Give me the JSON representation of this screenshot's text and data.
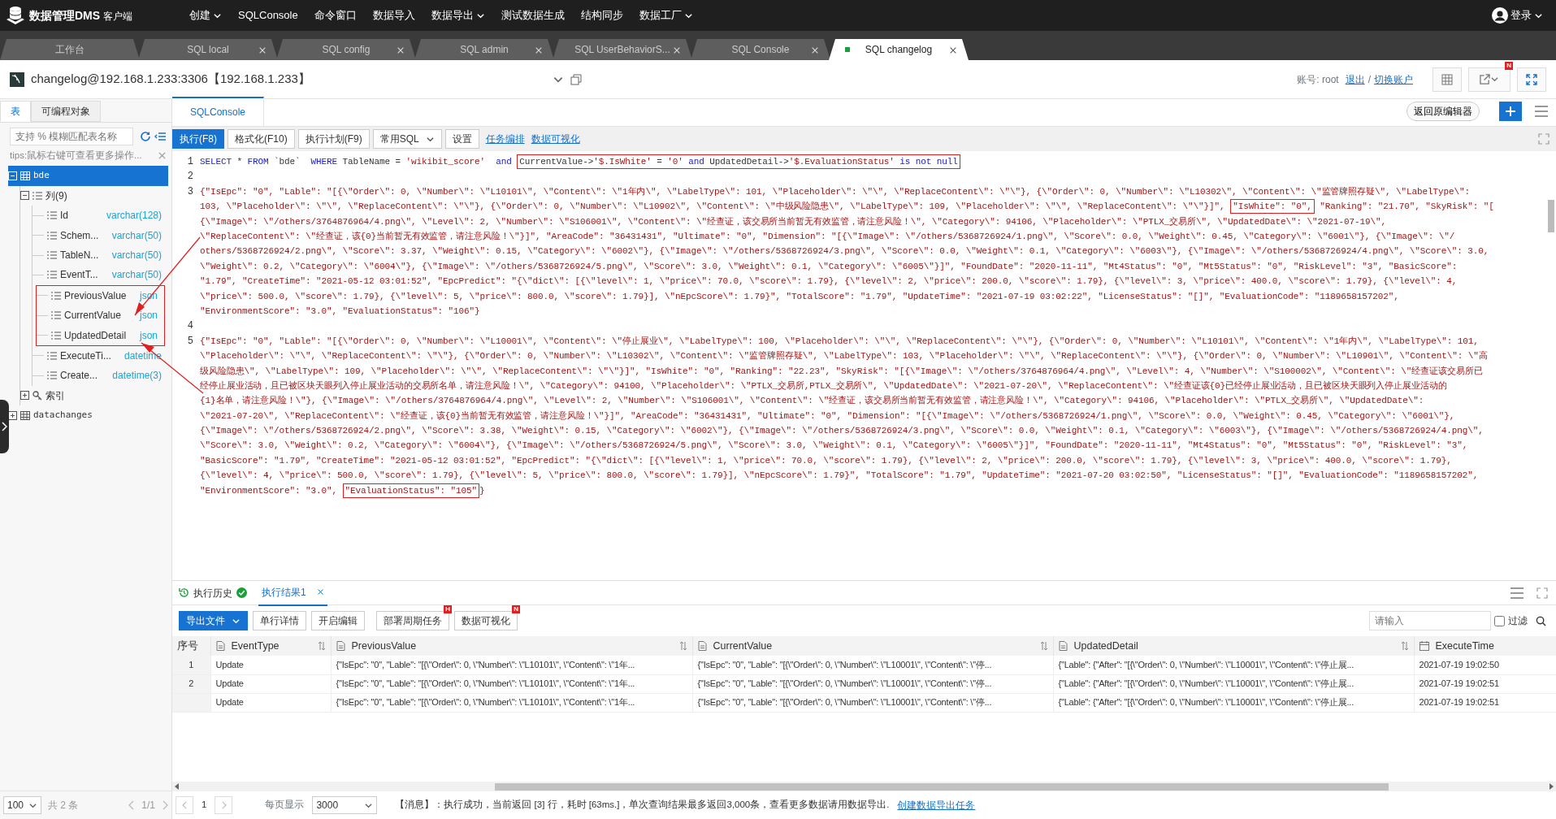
{
  "app": {
    "logo_text": "数据管理DMS",
    "logo_suffix": "客户端",
    "menu": [
      {
        "label": "创建",
        "dropdown": true
      },
      {
        "label": "SQLConsole",
        "dropdown": false
      },
      {
        "label": "命令窗口",
        "dropdown": false
      },
      {
        "label": "数据导入",
        "dropdown": false
      },
      {
        "label": "数据导出",
        "dropdown": true
      },
      {
        "label": "测试数据生成",
        "dropdown": false
      },
      {
        "label": "结构同步",
        "dropdown": false
      },
      {
        "label": "数据工厂",
        "dropdown": true
      }
    ],
    "user": "登录"
  },
  "tabs": [
    {
      "label": "工作台",
      "closable": false,
      "selected": false
    },
    {
      "label": "SQL local",
      "closable": true,
      "selected": false
    },
    {
      "label": "SQL config",
      "closable": true,
      "selected": false
    },
    {
      "label": "SQL admin",
      "closable": true,
      "selected": false
    },
    {
      "label": "SQL UserBehaviorS...",
      "closable": true,
      "selected": false
    },
    {
      "label": "SQL Console",
      "closable": true,
      "selected": false
    },
    {
      "label": "SQL changelog",
      "closable": true,
      "selected": true
    }
  ],
  "connection": {
    "title": "changelog@192.168.1.233:3306【192.168.1.233】",
    "account": "账号: root",
    "logout": "退出",
    "separator": "/",
    "switch": "切换账户",
    "badge": "N"
  },
  "sidebar": {
    "tabs": [
      {
        "label": "表",
        "selected": true
      },
      {
        "label": "可编程对象",
        "selected": false
      }
    ],
    "search": {
      "placeholder": "支持 % 模糊匹配表名称"
    },
    "tip": "tips:鼠标右键可查看更多操作...",
    "tree": [
      {
        "label": "bde",
        "kind": "table",
        "selected": true,
        "expanded": true,
        "children": [
          {
            "label": "列(9)",
            "kind": "group",
            "selected": false,
            "expanded": true,
            "children": [
              {
                "label": "Id",
                "kind": "column",
                "type": "varchar(128)",
                "boxed": false,
                "selected": false
              },
              {
                "label": "Schem...",
                "kind": "column",
                "type": "varchar(50)",
                "boxed": false,
                "selected": false
              },
              {
                "label": "TableN...",
                "kind": "column",
                "type": "varchar(50)",
                "boxed": false,
                "selected": false
              },
              {
                "label": "EventT...",
                "kind": "column",
                "type": "varchar(50)",
                "boxed": false,
                "selected": false
              },
              {
                "label": "PreviousValue",
                "kind": "column",
                "type": "json",
                "boxed": true,
                "selected": false
              },
              {
                "label": "CurrentValue",
                "kind": "column",
                "type": "json",
                "boxed": true,
                "selected": false
              },
              {
                "label": "UpdatedDetail",
                "kind": "column",
                "type": "json",
                "boxed": true,
                "selected": false
              },
              {
                "label": "ExecuteTi...",
                "kind": "column",
                "type": "datetime",
                "boxed": false,
                "selected": false
              },
              {
                "label": "Create...",
                "kind": "column",
                "type": "datetime(3)",
                "boxed": false,
                "selected": false
              }
            ]
          },
          {
            "label": "索引",
            "kind": "index",
            "selected": false,
            "expanded": false
          }
        ]
      },
      {
        "label": "datachanges",
        "kind": "table",
        "selected": false,
        "expanded": false
      }
    ],
    "pager": {
      "page_size": "100",
      "total": "共 2 条",
      "page": "1/1"
    }
  },
  "console": {
    "tabs": [
      {
        "label": "SQLConsole",
        "selected": true
      }
    ],
    "back_button": "返回原编辑器",
    "toolbar": [
      {
        "label": "执行(F8)",
        "kind": "primary"
      },
      {
        "label": "格式化(F10)",
        "kind": "button"
      },
      {
        "label": "执行计划(F9)",
        "kind": "button"
      },
      {
        "label": "常用SQL",
        "kind": "dropdown"
      },
      {
        "label": "设置",
        "kind": "button"
      },
      {
        "label": "任务编排",
        "kind": "link"
      },
      {
        "label": "数据可视化",
        "kind": "link"
      }
    ],
    "editor": {
      "lines": [
        {
          "number": "1",
          "rows": [
            [
              {
                "kind": "sql",
                "tokens": [
                  {
                    "kind": "keyword",
                    "text": "SELECT"
                  },
                  {
                    "kind": "plain",
                    "text": " * "
                  },
                  {
                    "kind": "keyword",
                    "text": "FROM"
                  },
                  {
                    "kind": "plain",
                    "text": " `bde`  "
                  },
                  {
                    "kind": "keyword",
                    "text": "WHERE"
                  },
                  {
                    "kind": "plain",
                    "text": " TableName = "
                  },
                  {
                    "kind": "string",
                    "text": "'wikibit_score'"
                  },
                  {
                    "kind": "keyword",
                    "text": "  and"
                  }
                ]
              },
              {
                "kind": "box",
                "parts": [
                  {
                    "kind": "sql",
                    "tokens": [
                      {
                        "kind": "plain",
                        "text": "CurrentValue->"
                      },
                      {
                        "kind": "string",
                        "text": "'$.IsWhite'"
                      },
                      {
                        "kind": "plain",
                        "text": " = "
                      },
                      {
                        "kind": "string",
                        "text": "'0'"
                      },
                      {
                        "kind": "keyword",
                        "text": " and"
                      },
                      {
                        "kind": "plain",
                        "text": " UpdatedDetail->"
                      },
                      {
                        "kind": "string",
                        "text": "'$.EvaluationStatus'"
                      },
                      {
                        "kind": "keyword",
                        "text": " is not null"
                      }
                    ]
                  }
                ]
              }
            ]
          ]
        },
        {
          "number": "2"
        },
        {
          "number": "3",
          "rows": [
            [
              {
                "kind": "json",
                "text": "{\"IsEpc\": \"0\", \"Lable\": \"[{\\\"Order\\\": 0, \\\"Number\\\": \\\"L10101\\\", \\\"Content\\\": \\\"1年内\\\", \\\"LabelType\\\": 101, \\\"Placeholder\\\": \\\"\\\", \\\"ReplaceContent\\\": \\\"\\\"}, {\\\"Order\\\": 0, \\\"Number\\\": \\\"L10302\\\", \\\"Content\\\": \\\"监管牌照存疑\\\", \\\"LabelType\\\":"
              }
            ],
            [
              {
                "kind": "json",
                "text": "103, \\\"Placeholder\\\": \\\"\\\", \\\"ReplaceContent\\\": \\\"\\\"}, {\\\"Order\\\": 0, \\\"Number\\\": \\\"L10902\\\", \\\"Content\\\": \\\"中级风险隐患\\\", \\\"LabelType\\\": 109, \\\"Placeholder\\\": \\\"\\\", \\\"ReplaceContent\\\": \\\"\\\"}]\","
              },
              {
                "kind": "box",
                "parts": [
                  {
                    "kind": "json",
                    "text": "\"IsWhite\": \"0\","
                  }
                ]
              },
              {
                "kind": "json",
                "text": "\"Ranking\": \"21.70\", \"SkyRisk\": \"["
              }
            ],
            [
              {
                "kind": "json",
                "text": "{\\\"Image\\\": \\\"/others/3764876964/4.png\\\", \\\"Level\\\": 2, \\\"Number\\\": \\\"S106001\\\", \\\"Content\\\": \\\"经查证，该交易所当前暂无有效监管，请注意风险！\\\", \\\"Category\\\": 94106, \\\"Placeholder\\\": \\\"PTLX_交易所\\\", \\\"UpdatedDate\\\": \\\"2021-07-19\\\","
              }
            ],
            [
              {
                "kind": "json",
                "text": "\\\"ReplaceContent\\\": \\\"经查证，该{0}当前暂无有效监管，请注意风险！\\\"}]\", \"AreaCode\": \"36431431\", \"Ultimate\": \"0\", \"Dimension\": \"[{\\\"Image\\\": \\\"/others/5368726924/1.png\\\", \\\"Score\\\": 0.0, \\\"Weight\\\": 0.45, \\\"Category\\\": \\\"6001\\\"}, {\\\"Image\\\": \\\"/"
              }
            ],
            [
              {
                "kind": "json",
                "text": "others/5368726924/2.png\\\", \\\"Score\\\": 3.37, \\\"Weight\\\": 0.15, \\\"Category\\\": \\\"6002\\\"}, {\\\"Image\\\": \\\"/others/5368726924/3.png\\\", \\\"Score\\\": 0.0, \\\"Weight\\\": 0.1, \\\"Category\\\": \\\"6003\\\"}, {\\\"Image\\\": \\\"/others/5368726924/4.png\\\", \\\"Score\\\": 3.0,"
              }
            ],
            [
              {
                "kind": "json",
                "text": "\\\"Weight\\\": 0.2, \\\"Category\\\": \\\"6004\\\"}, {\\\"Image\\\": \\\"/others/5368726924/5.png\\\", \\\"Score\\\": 3.0, \\\"Weight\\\": 0.1, \\\"Category\\\": \\\"6005\\\"}]\", \"FoundDate\": \"2020-11-11\", \"Mt4Status\": \"0\", \"Mt5Status\": \"0\", \"RiskLevel\": \"3\", \"BasicScore\":"
              }
            ],
            [
              {
                "kind": "json",
                "text": "\"1.79\", \"CreateTime\": \"2021-05-12 03:01:52\", \"EpcPredict\": \"{\\\"dict\\\": [{\\\"level\\\": 1, \\\"price\\\": 70.0, \\\"score\\\": 1.79}, {\\\"level\\\": 2, \\\"price\\\": 200.0, \\\"score\\\": 1.79}, {\\\"level\\\": 3, \\\"price\\\": 400.0, \\\"score\\\": 1.79}, {\\\"level\\\": 4,"
              }
            ],
            [
              {
                "kind": "json",
                "text": "\\\"price\\\": 500.0, \\\"score\\\": 1.79}, {\\\"level\\\": 5, \\\"price\\\": 800.0, \\\"score\\\": 1.79}], \\\"nEpcScore\\\": 1.79}\", \"TotalScore\": \"1.79\", \"UpdateTime\": \"2021-07-19 03:02:22\", \"LicenseStatus\": \"[]\", \"EvaluationCode\": \"1189658157202\","
              }
            ],
            [
              {
                "kind": "json",
                "text": "\"EnvironmentScore\": \"3.0\", \"EvaluationStatus\": \"106\"}"
              }
            ]
          ]
        },
        {
          "number": "4"
        },
        {
          "number": "5",
          "rows": [
            [
              {
                "kind": "json",
                "text": "{\"IsEpc\": \"0\", \"Lable\": \"[{\\\"Order\\\": 0, \\\"Number\\\": \\\"L10001\\\", \\\"Content\\\": \\\"停止展业\\\", \\\"LabelType\\\": 100, \\\"Placeholder\\\": \\\"\\\", \\\"ReplaceContent\\\": \\\"\\\"}, {\\\"Order\\\": 0, \\\"Number\\\": \\\"L10101\\\", \\\"Content\\\": \\\"1年内\\\", \\\"LabelType\\\": 101,"
              }
            ],
            [
              {
                "kind": "json",
                "text": "\\\"Placeholder\\\": \\\"\\\", \\\"ReplaceContent\\\": \\\"\\\"}, {\\\"Order\\\": 0, \\\"Number\\\": \\\"L10302\\\", \\\"Content\\\": \\\"监管牌照存疑\\\", \\\"LabelType\\\": 103, \\\"Placeholder\\\": \\\"\\\", \\\"ReplaceContent\\\": \\\"\\\"}, {\\\"Order\\\": 0, \\\"Number\\\": \\\"L10901\\\", \\\"Content\\\": \\\"高"
              }
            ],
            [
              {
                "kind": "json",
                "text": "级风险隐患\\\", \\\"LabelType\\\": 109, \\\"Placeholder\\\": \\\"\\\", \\\"ReplaceContent\\\": \\\"\\\"}]\", \"IsWhite\": \"0\", \"Ranking\": \"22.23\", \"SkyRisk\": \"[{\\\"Image\\\": \\\"/others/3764876964/4.png\\\", \\\"Level\\\": 4, \\\"Number\\\": \\\"S100002\\\", \\\"Content\\\": \\\"经查证该交易所已"
              }
            ],
            [
              {
                "kind": "json",
                "text": "经停止展业活动，且已被区块天眼列入停止展业活动的交易所名单，请注意风险！\\\", \\\"Category\\\": 94100, \\\"Placeholder\\\": \\\"PTLX_交易所,PTLX_交易所\\\", \\\"UpdatedDate\\\": \\\"2021-07-20\\\", \\\"ReplaceContent\\\": \\\"经查证该{0}已经停止展业活动，且已被区块天眼列入停止展业活动的"
              }
            ],
            [
              {
                "kind": "json",
                "text": "{1}名单，请注意风险！\\\"}, {\\\"Image\\\": \\\"/others/3764876964/4.png\\\", \\\"Level\\\": 2, \\\"Number\\\": \\\"S106001\\\", \\\"Content\\\": \\\"经查证，该交易所当前暂无有效监管，请注意风险！\\\", \\\"Category\\\": 94106, \\\"Placeholder\\\": \\\"PTLX_交易所\\\", \\\"UpdatedDate\\\":"
              }
            ],
            [
              {
                "kind": "json",
                "text": "\\\"2021-07-20\\\", \\\"ReplaceContent\\\": \\\"经查证，该{0}当前暂无有效监管，请注意风险！\\\"}]\", \"AreaCode\": \"36431431\", \"Ultimate\": \"0\", \"Dimension\": \"[{\\\"Image\\\": \\\"/others/5368726924/1.png\\\", \\\"Score\\\": 0.0, \\\"Weight\\\": 0.45, \\\"Category\\\": \\\"6001\\\"},"
              }
            ],
            [
              {
                "kind": "json",
                "text": "{\\\"Image\\\": \\\"/others/5368726924/2.png\\\", \\\"Score\\\": 3.38, \\\"Weight\\\": 0.15, \\\"Category\\\": \\\"6002\\\"}, {\\\"Image\\\": \\\"/others/5368726924/3.png\\\", \\\"Score\\\": 0.0, \\\"Weight\\\": 0.1, \\\"Category\\\": \\\"6003\\\"}, {\\\"Image\\\": \\\"/others/5368726924/4.png\\\","
              }
            ],
            [
              {
                "kind": "json",
                "text": "\\\"Score\\\": 3.0, \\\"Weight\\\": 0.2, \\\"Category\\\": \\\"6004\\\"}, {\\\"Image\\\": \\\"/others/5368726924/5.png\\\", \\\"Score\\\": 3.0, \\\"Weight\\\": 0.1, \\\"Category\\\": \\\"6005\\\"}]\", \"FoundDate\": \"2020-11-11\", \"Mt4Status\": \"0\", \"Mt5Status\": \"0\", \"RiskLevel\": \"3\","
              }
            ],
            [
              {
                "kind": "json",
                "text": "\"BasicScore\": \"1.79\", \"CreateTime\": \"2021-05-12 03:01:52\", \"EpcPredict\": \"{\\\"dict\\\": [{\\\"level\\\": 1, \\\"price\\\": 70.0, \\\"score\\\": 1.79}, {\\\"level\\\": 2, \\\"price\\\": 200.0, \\\"score\\\": 1.79}, {\\\"level\\\": 3, \\\"price\\\": 400.0, \\\"score\\\": 1.79},"
              }
            ],
            [
              {
                "kind": "json",
                "text": "{\\\"level\\\": 4, \\\"price\\\": 500.0, \\\"score\\\": 1.79}, {\\\"level\\\": 5, \\\"price\\\": 800.0, \\\"score\\\": 1.79}], \\\"nEpcScore\\\": 1.79}\", \"TotalScore\": \"1.79\", \"UpdateTime\": \"2021-07-20 03:02:50\", \"LicenseStatus\": \"[]\", \"EvaluationCode\": \"1189658157202\","
              }
            ],
            [
              {
                "kind": "json",
                "text": "\"EnvironmentScore\": \"3.0\","
              },
              {
                "kind": "box",
                "parts": [
                  {
                    "kind": "json",
                    "text": "\"EvaluationStatus\": \"105\""
                  }
                ]
              },
              {
                "kind": "json",
                "text": "}"
              }
            ]
          ]
        }
      ]
    }
  },
  "results": {
    "tabs": [
      {
        "label": "执行历史",
        "kind": "history",
        "selected": false
      },
      {
        "label": "执行结果1",
        "kind": "result",
        "selected": true
      }
    ],
    "toolbar": [
      {
        "label": "导出文件",
        "kind": "primary-dropdown"
      },
      {
        "label": "单行详情",
        "kind": "button"
      },
      {
        "label": "开启编辑",
        "kind": "button"
      },
      {
        "label": "部署周期任务",
        "kind": "button",
        "badge": "H"
      },
      {
        "label": "数据可视化",
        "kind": "button",
        "badge": "N"
      }
    ],
    "search": {
      "placeholder": "请输入"
    },
    "filter": {
      "label": "过滤",
      "checked": false
    },
    "table": {
      "columns": [
        {
          "label": "序号",
          "kind": "index"
        },
        {
          "label": "EventType",
          "kind": "field"
        },
        {
          "label": "PreviousValue",
          "kind": "field"
        },
        {
          "label": "CurrentValue",
          "kind": "field"
        },
        {
          "label": "UpdatedDetail",
          "kind": "field"
        },
        {
          "label": "ExecuteTime",
          "kind": "time"
        }
      ],
      "rows": [
        {
          "cells": [
            "1",
            "Update",
            "{\"IsEpc\": \"0\", \"Lable\": \"[{\\\"Order\\\": 0, \\\"Number\\\": \\\"L10101\\\", \\\"Content\\\": \\\"1年...",
            "{\"IsEpc\": \"0\", \"Lable\": \"[{\\\"Order\\\": 0, \\\"Number\\\": \\\"L10001\\\", \\\"Content\\\": \\\"停...",
            "{\"Lable\": {\"After\": \"[{\\\"Order\\\": 0, \\\"Number\\\": \\\"L10001\\\", \\\"Content\\\": \\\"停止展...",
            "2021-07-19 19:02:50"
          ]
        },
        {
          "cells": [
            "2",
            "Update",
            "{\"IsEpc\": \"0\", \"Lable\": \"[{\\\"Order\\\": 0, \\\"Number\\\": \\\"L10101\\\", \\\"Content\\\": \\\"1年...",
            "{\"IsEpc\": \"0\", \"Lable\": \"[{\\\"Order\\\": 0, \\\"Number\\\": \\\"L10001\\\", \\\"Content\\\": \\\"停...",
            "{\"Lable\": {\"After\": \"[{\\\"Order\\\": 0, \\\"Number\\\": \\\"L10001\\\", \\\"Content\\\": \\\"停止展...",
            "2021-07-19 19:02:51"
          ]
        },
        {
          "cells": [
            "",
            "Update",
            "{\"IsEpc\": \"0\", \"Lable\": \"[{\\\"Order\\\": 0, \\\"Number\\\": \\\"L10101\\\", \\\"Content\\\": \\\"1年...",
            "{\"IsEpc\": \"0\", \"Lable\": \"[{\\\"Order\\\": 0, \\\"Number\\\": \\\"L10001\\\", \\\"Content\\\": \\\"停...",
            "{\"Lable\": {\"After\": \"[{\\\"Order\\\": 0, \\\"Number\\\": \\\"L10001\\\", \\\"Content\\\": \\\"停止展...",
            "2021-07-19 19:02:51"
          ]
        }
      ]
    },
    "pager": {
      "page": "1",
      "per_page_label": "每页显示",
      "per_page": "3000"
    },
    "message": "【消息】：执行成功，当前返回 [3] 行，耗时 [63ms.]，单次查询结果最多返回3,000条，查看更多数据请用数据导出.",
    "message_link": "创建数据导出任务"
  }
}
